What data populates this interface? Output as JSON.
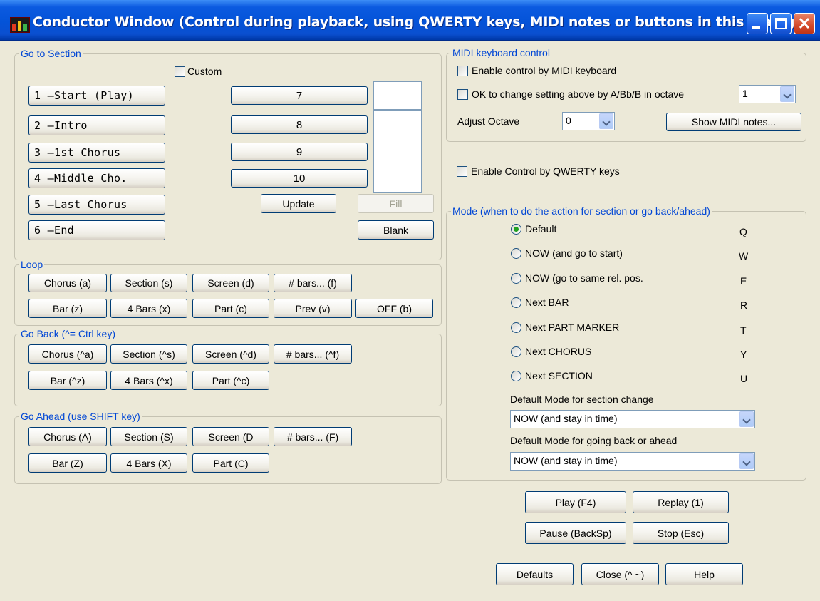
{
  "window": {
    "title": "Conductor Window (Control during playback, using QWERTY keys, MIDI notes or buttons in this dialog)"
  },
  "goto_section": {
    "legend": "Go to Section",
    "custom_label": "Custom",
    "custom_checked": false,
    "buttons": [
      "1 –Start (Play)",
      "2 –Intro",
      "3 –1st Chorus",
      "4 –Middle Cho.",
      "5 –Last Chorus",
      "6 –End"
    ],
    "buttons_right": [
      "7",
      "8",
      "9",
      "10"
    ],
    "update_label": "Update",
    "fill_label": "Fill",
    "blank_label": "Blank"
  },
  "loop": {
    "legend": "Loop",
    "row1": [
      "Chorus (a)",
      "Section (s)",
      "Screen (d)",
      "# bars... (f)"
    ],
    "row2": [
      "Bar (z)",
      "4 Bars (x)",
      "Part (c)",
      "Prev (v)",
      "OFF (b)"
    ]
  },
  "go_back": {
    "legend": "Go Back  (^= Ctrl key)",
    "row1": [
      "Chorus (^a)",
      "Section (^s)",
      "Screen (^d)",
      "# bars... (^f)"
    ],
    "row2": [
      "Bar (^z)",
      "4 Bars (^x)",
      "Part (^c)"
    ]
  },
  "go_ahead": {
    "legend": "Go Ahead  (use SHIFT key)",
    "row1": [
      "Chorus (A)",
      "Section (S)",
      "Screen (D",
      "# bars... (F)"
    ],
    "row2": [
      "Bar (Z)",
      "4 Bars (X)",
      "Part (C)"
    ]
  },
  "midi": {
    "legend": "MIDI keyboard control",
    "enable_label": "Enable control by MIDI keyboard",
    "ok_change_label": "OK to change setting above by  A/Bb/B in octave",
    "octave_select_value": "1",
    "adjust_octave_label": "Adjust Octave",
    "adjust_octave_value": "0",
    "show_notes_label": "Show MIDI notes..."
  },
  "qwerty": {
    "enable_label": "Enable Control by QWERTY keys"
  },
  "mode": {
    "legend": "Mode (when to do the action for section or go back/ahead)",
    "options": [
      {
        "label": "Default",
        "key": "Q",
        "selected": true
      },
      {
        "label": "NOW (and go to start)",
        "key": "W",
        "selected": false
      },
      {
        "label": "NOW (go to same rel. pos.",
        "key": "E",
        "selected": false
      },
      {
        "label": "Next BAR",
        "key": "R",
        "selected": false
      },
      {
        "label": "Next PART MARKER",
        "key": "T",
        "selected": false
      },
      {
        "label": "Next CHORUS",
        "key": "Y",
        "selected": false
      },
      {
        "label": "Next SECTION",
        "key": "U",
        "selected": false
      }
    ],
    "section_change_label": "Default Mode for section change",
    "section_change_value": "NOW (and stay in time)",
    "back_ahead_label": "Default Mode for going back or ahead",
    "back_ahead_value": "NOW (and stay in time)"
  },
  "transport": {
    "play": "Play (F4)",
    "replay": "Replay (1)",
    "pause": "Pause (BackSp)",
    "stop": "Stop (Esc)"
  },
  "footer": {
    "defaults": "Defaults",
    "close": "Close (^ ~)",
    "help": "Help"
  }
}
